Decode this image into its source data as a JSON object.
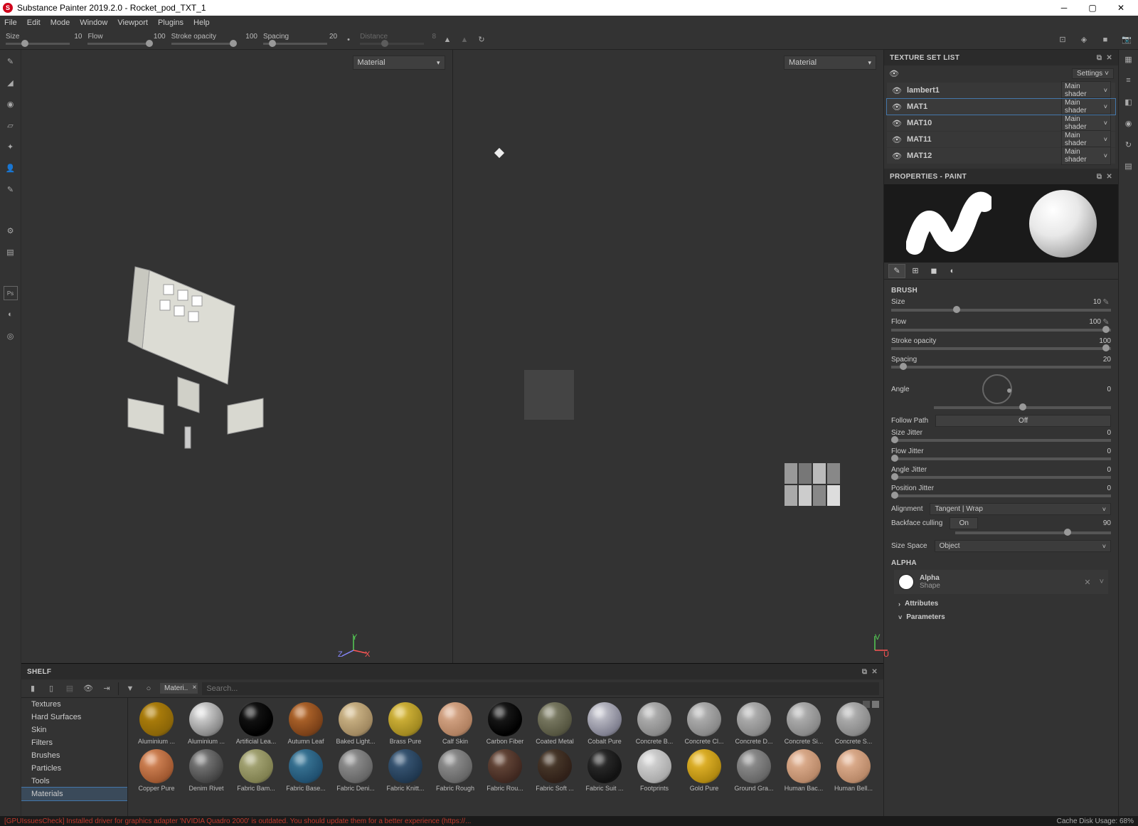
{
  "title": "Substance Painter 2019.2.0 - Rocket_pod_TXT_1",
  "menu": [
    "File",
    "Edit",
    "Mode",
    "Window",
    "Viewport",
    "Plugins",
    "Help"
  ],
  "topSliders": {
    "size": {
      "label": "Size",
      "value": "10"
    },
    "flow": {
      "label": "Flow",
      "value": "100"
    },
    "stroke": {
      "label": "Stroke opacity",
      "value": "100"
    },
    "spacing": {
      "label": "Spacing",
      "value": "20"
    },
    "distance": {
      "label": "Distance",
      "value": "8"
    }
  },
  "viewportDrop": "Material",
  "axis3d": {
    "z": "Z",
    "y": "Y",
    "x": "X"
  },
  "axis2d": {
    "v": "V",
    "u": "U"
  },
  "panels": {
    "textureSet": {
      "title": "TEXTURE SET LIST",
      "settings": "Settings"
    },
    "properties": {
      "title": "PROPERTIES - PAINT"
    }
  },
  "textureSets": [
    {
      "name": "lambert1",
      "shader": "Main shader",
      "selected": false
    },
    {
      "name": "MAT1",
      "shader": "Main shader",
      "selected": true
    },
    {
      "name": "MAT10",
      "shader": "Main shader",
      "selected": false
    },
    {
      "name": "MAT11",
      "shader": "Main shader",
      "selected": false
    },
    {
      "name": "MAT12",
      "shader": "Main shader",
      "selected": false
    }
  ],
  "brushSection": "BRUSH",
  "brush": {
    "size": {
      "label": "Size",
      "value": "10"
    },
    "flow": {
      "label": "Flow",
      "value": "100"
    },
    "stroke": {
      "label": "Stroke opacity",
      "value": "100"
    },
    "spacing": {
      "label": "Spacing",
      "value": "20"
    },
    "angle": {
      "label": "Angle",
      "value": "0"
    },
    "follow": {
      "label": "Follow Path",
      "value": "Off"
    },
    "sizeJitter": {
      "label": "Size Jitter",
      "value": "0"
    },
    "flowJitter": {
      "label": "Flow Jitter",
      "value": "0"
    },
    "angleJitter": {
      "label": "Angle Jitter",
      "value": "0"
    },
    "posJitter": {
      "label": "Position Jitter",
      "value": "0"
    },
    "alignment": {
      "label": "Alignment",
      "value": "Tangent | Wrap"
    },
    "backface": {
      "label": "Backface culling",
      "value": "On",
      "value2": "90"
    },
    "sizeSpace": {
      "label": "Size Space",
      "value": "Object"
    }
  },
  "alphaSection": "ALPHA",
  "alpha": {
    "name": "Alpha",
    "sub": "Shape"
  },
  "attributes": "Attributes",
  "parameters": "Parameters",
  "shelf": {
    "title": "SHELF",
    "chip": "Materi..",
    "searchPlaceholder": "Search...",
    "categories": [
      "Textures",
      "Hard Surfaces",
      "Skin",
      "Filters",
      "Brushes",
      "Particles",
      "Tools",
      "Materials"
    ],
    "activeCat": "Materials"
  },
  "materials": [
    {
      "name": "Aluminium ...",
      "c1": "#b8860b",
      "c2": "#8a6508"
    },
    {
      "name": "Aluminium ...",
      "c1": "#e8e8e8",
      "c2": "#888"
    },
    {
      "name": "Artificial Lea...",
      "c1": "#1a1a1a",
      "c2": "#000"
    },
    {
      "name": "Autumn Leaf",
      "c1": "#c07030",
      "c2": "#7a4018"
    },
    {
      "name": "Baked Light...",
      "c1": "#d8c090",
      "c2": "#a08860"
    },
    {
      "name": "Brass Pure",
      "c1": "#e0c040",
      "c2": "#a08820"
    },
    {
      "name": "Calf Skin",
      "c1": "#e0b090",
      "c2": "#b08060"
    },
    {
      "name": "Carbon Fiber",
      "c1": "#222",
      "c2": "#000"
    },
    {
      "name": "Coated Metal",
      "c1": "#888870",
      "c2": "#555540"
    },
    {
      "name": "Cobalt Pure",
      "c1": "#d0d0d8",
      "c2": "#808090"
    },
    {
      "name": "Concrete B...",
      "c1": "#bbb",
      "c2": "#888"
    },
    {
      "name": "Concrete Cl...",
      "c1": "#bbb",
      "c2": "#888"
    },
    {
      "name": "Concrete D...",
      "c1": "#bbb",
      "c2": "#888"
    },
    {
      "name": "Concrete Si...",
      "c1": "#bbb",
      "c2": "#888"
    },
    {
      "name": "Concrete S...",
      "c1": "#bbb",
      "c2": "#888"
    },
    {
      "name": "Copper Pure",
      "c1": "#e09060",
      "c2": "#a05830"
    },
    {
      "name": "Denim Rivet",
      "c1": "#888",
      "c2": "#444"
    },
    {
      "name": "Fabric Bam...",
      "c1": "#b0b080",
      "c2": "#808050"
    },
    {
      "name": "Fabric Base...",
      "c1": "#4080a0",
      "c2": "#205070"
    },
    {
      "name": "Fabric Deni...",
      "c1": "#999",
      "c2": "#666"
    },
    {
      "name": "Fabric Knitt...",
      "c1": "#406080",
      "c2": "#203850"
    },
    {
      "name": "Fabric Rough",
      "c1": "#999",
      "c2": "#666"
    },
    {
      "name": "Fabric Rou...",
      "c1": "#705040",
      "c2": "#402820"
    },
    {
      "name": "Fabric Soft ...",
      "c1": "#504030",
      "c2": "#302018"
    },
    {
      "name": "Fabric Suit ...",
      "c1": "#333",
      "c2": "#111"
    },
    {
      "name": "Footprints",
      "c1": "#ddd",
      "c2": "#aaa"
    },
    {
      "name": "Gold Pure",
      "c1": "#f0c030",
      "c2": "#b08810"
    },
    {
      "name": "Ground Gra...",
      "c1": "#999",
      "c2": "#666"
    },
    {
      "name": "Human Bac...",
      "c1": "#e8b898",
      "c2": "#b88868"
    },
    {
      "name": "Human Bell...",
      "c1": "#e8b898",
      "c2": "#b88868"
    }
  ],
  "status": {
    "warn": "[GPUIssuesCheck] Installed driver for graphics adapter 'NVIDIA Quadro 2000' is outdated. You should update them for a better experience (https://...",
    "cache": "Cache Disk Usage:   68%"
  }
}
